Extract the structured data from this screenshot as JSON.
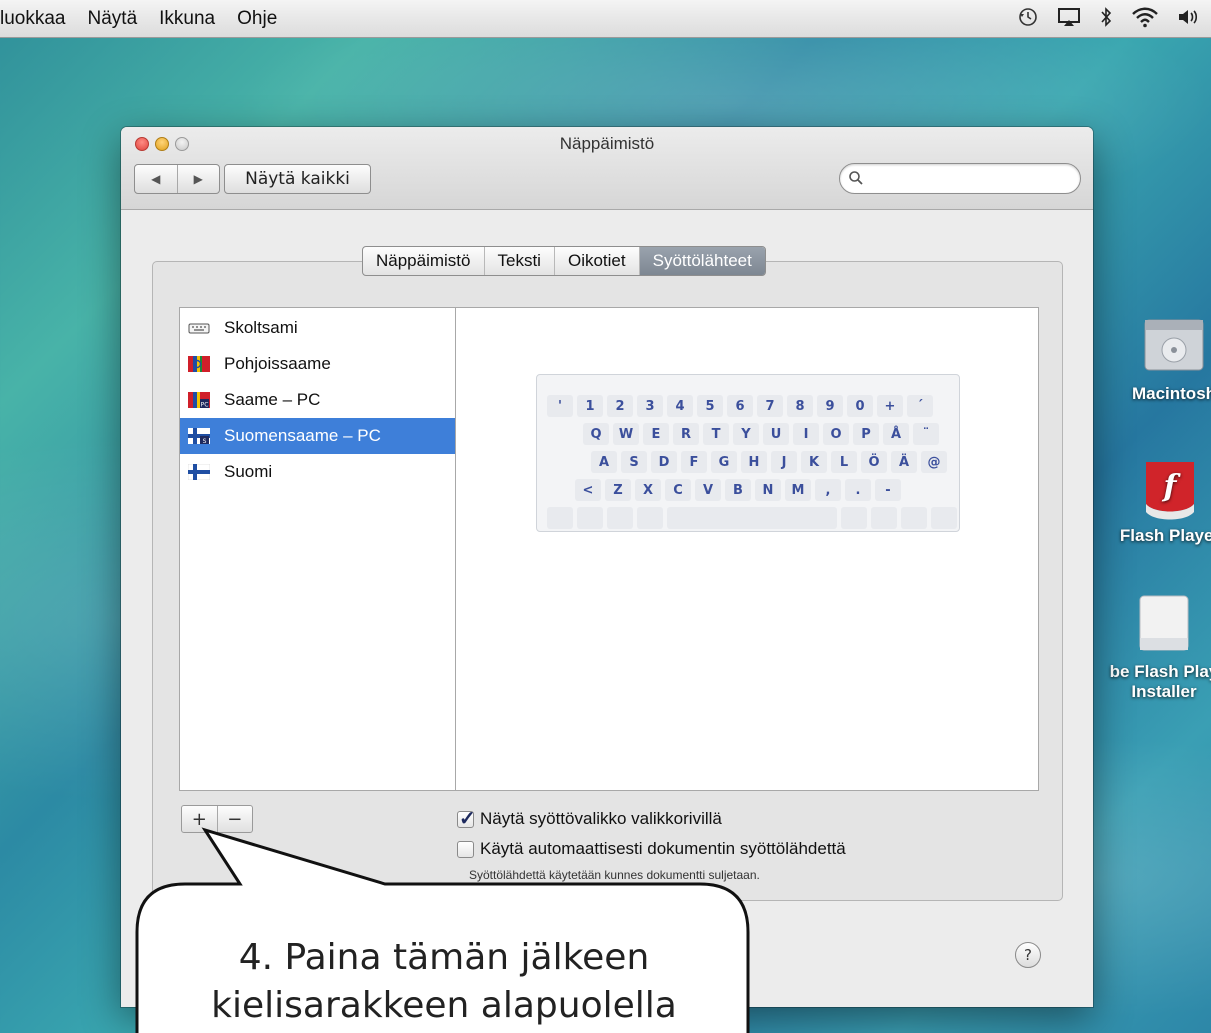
{
  "menubar": {
    "items": [
      "luokkaa",
      "Näytä",
      "Ikkuna",
      "Ohje"
    ]
  },
  "window": {
    "title": "Näppäimistö",
    "show_all_label": "Näytä kaikki",
    "search_placeholder": ""
  },
  "tabs": [
    {
      "label": "Näppäimistö",
      "active": false
    },
    {
      "label": "Teksti",
      "active": false
    },
    {
      "label": "Oikotiet",
      "active": false
    },
    {
      "label": "Syöttölähteet",
      "active": true
    }
  ],
  "input_sources": [
    {
      "label": "Skoltsami",
      "icon": "keyboard-icon",
      "selected": false
    },
    {
      "label": "Pohjoissaame",
      "icon": "sami-flag-icon",
      "selected": false
    },
    {
      "label": "Saame – PC",
      "icon": "sami-pc-flag-icon",
      "selected": false
    },
    {
      "label": "Suomensaame – PC",
      "icon": "finnish-sami-flag-icon",
      "selected": true
    },
    {
      "label": "Suomi",
      "icon": "finland-flag-icon",
      "selected": false
    }
  ],
  "keyboard_rows": [
    [
      "'",
      "1",
      "2",
      "3",
      "4",
      "5",
      "6",
      "7",
      "8",
      "9",
      "0",
      "+",
      "´"
    ],
    [
      "Q",
      "W",
      "E",
      "R",
      "T",
      "Y",
      "U",
      "I",
      "O",
      "P",
      "Å",
      "¨"
    ],
    [
      "A",
      "S",
      "D",
      "F",
      "G",
      "H",
      "J",
      "K",
      "L",
      "Ö",
      "Ä",
      "@"
    ],
    [
      "<",
      "Z",
      "X",
      "C",
      "V",
      "B",
      "N",
      "M",
      ",",
      ".",
      "-"
    ]
  ],
  "buttons": {
    "add": "+",
    "remove": "−",
    "help": "?"
  },
  "options": {
    "show_menu_label": "Näytä syöttövalikko valikkorivillä",
    "show_menu_checked": true,
    "auto_switch_label": "Käytä automaattisesti dokumentin syöttölähdettä",
    "auto_switch_checked": false,
    "note": "Syöttölähdettä käytetään kunnes dokumentti suljetaan."
  },
  "desktop_icons": [
    {
      "label": "Macintosh",
      "icon": "hard-drive-icon"
    },
    {
      "label": "Flash Player",
      "icon": "flash-player-icon"
    },
    {
      "label_line1": "be Flash Play",
      "label_line2": "Installer",
      "icon": "disk-image-icon"
    }
  ],
  "callout": {
    "line1": "4. Paina tämän jälkeen",
    "line2": "kielisarakkeen alapuolella"
  },
  "colors": {
    "selection": "#3e7fd9",
    "key_text": "#3b4f9c",
    "flash_red": "#d0242a"
  }
}
